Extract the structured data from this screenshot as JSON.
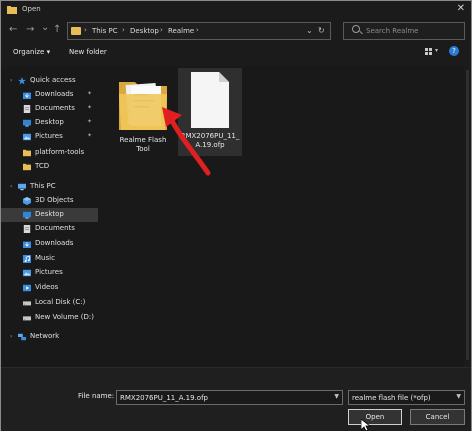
{
  "window": {
    "title": "Open",
    "close_glyph": "✕"
  },
  "nav": {
    "back": "←",
    "forward": "→",
    "recent": "⌄",
    "up": "↑"
  },
  "address": {
    "breadcrumbs": [
      "This PC",
      "Desktop",
      "Realme"
    ],
    "separator": "›",
    "dropdown": "⌄",
    "refresh": "↻"
  },
  "search": {
    "placeholder": "Search Realme"
  },
  "toolbar": {
    "organize": "Organize ▾",
    "new_folder": "New folder",
    "help": "?"
  },
  "sidebar": {
    "items": [
      {
        "label": "Quick access",
        "icon": "star-icon"
      },
      {
        "label": "Downloads",
        "icon": "download-folder-icon",
        "pinned": true
      },
      {
        "label": "Documents",
        "icon": "documents-folder-icon",
        "pinned": true
      },
      {
        "label": "Desktop",
        "icon": "desktop-folder-icon",
        "pinned": true
      },
      {
        "label": "Pictures",
        "icon": "pictures-folder-icon",
        "pinned": true
      },
      {
        "label": "platform-tools",
        "icon": "folder-icon"
      },
      {
        "label": "TCD",
        "icon": "folder-icon"
      },
      {
        "label": "This PC",
        "icon": "computer-icon"
      },
      {
        "label": "3D Objects",
        "icon": "3d-objects-icon"
      },
      {
        "label": "Desktop",
        "icon": "desktop-folder-icon",
        "selected": true
      },
      {
        "label": "Documents",
        "icon": "documents-folder-icon"
      },
      {
        "label": "Downloads",
        "icon": "download-folder-icon"
      },
      {
        "label": "Music",
        "icon": "music-icon"
      },
      {
        "label": "Pictures",
        "icon": "pictures-folder-icon"
      },
      {
        "label": "Videos",
        "icon": "videos-icon"
      },
      {
        "label": "Local Disk (C:)",
        "icon": "drive-icon"
      },
      {
        "label": "New Volume (D:)",
        "icon": "drive-icon"
      },
      {
        "label": "Network",
        "icon": "network-icon"
      }
    ],
    "pin_glyph": "📌",
    "caret_glyph": "›"
  },
  "files": [
    {
      "name_line1": "Realme Flash",
      "name_line2": "Tool",
      "type": "folder",
      "icon": "folder-icon"
    },
    {
      "name_line1": "RMX2076PU_11_",
      "name_line2": "A.19.ofp",
      "type": "file",
      "icon": "blank-file-icon",
      "selected": true
    }
  ],
  "footer": {
    "file_name_label": "File name:",
    "file_name_value": "RMX2076PU_11_A.19.ofp",
    "file_type_value": "realme flash file (*ofp)",
    "open_label": "Open",
    "cancel_label": "Cancel"
  },
  "colors": {
    "accent": "#2b7bd6",
    "arrow": "#e02020",
    "folder": "#e7bd56"
  }
}
